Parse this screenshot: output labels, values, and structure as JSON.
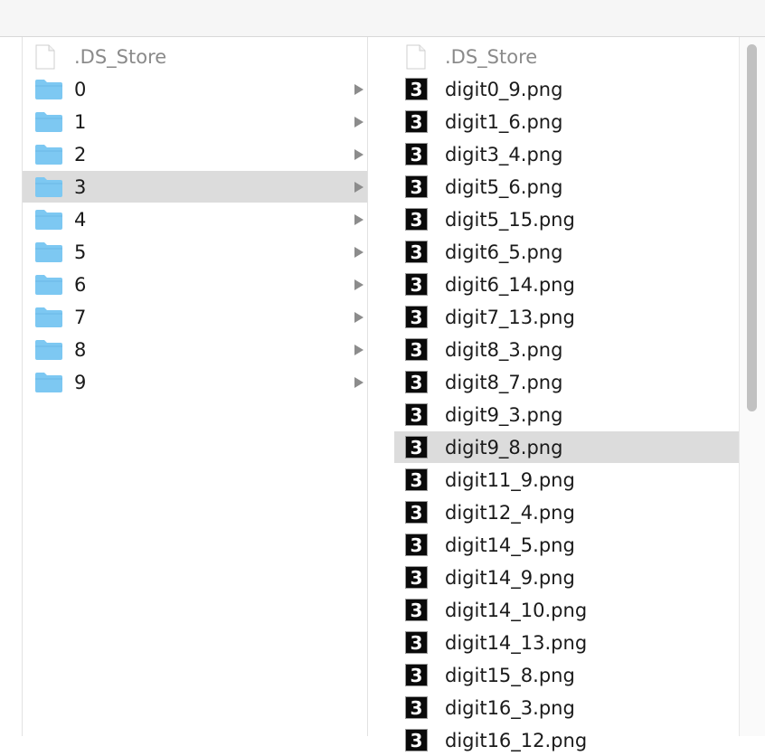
{
  "left_column": {
    "items": [
      {
        "label": ".DS_Store",
        "type": "file",
        "icon": "document-icon"
      },
      {
        "label": "0",
        "type": "folder",
        "icon": "folder-icon"
      },
      {
        "label": "1",
        "type": "folder",
        "icon": "folder-icon"
      },
      {
        "label": "2",
        "type": "folder",
        "icon": "folder-icon"
      },
      {
        "label": "3",
        "type": "folder",
        "icon": "folder-icon",
        "selected": true
      },
      {
        "label": "4",
        "type": "folder",
        "icon": "folder-icon"
      },
      {
        "label": "5",
        "type": "folder",
        "icon": "folder-icon"
      },
      {
        "label": "6",
        "type": "folder",
        "icon": "folder-icon"
      },
      {
        "label": "7",
        "type": "folder",
        "icon": "folder-icon"
      },
      {
        "label": "8",
        "type": "folder",
        "icon": "folder-icon"
      },
      {
        "label": "9",
        "type": "folder",
        "icon": "folder-icon"
      }
    ]
  },
  "right_column": {
    "items": [
      {
        "label": ".DS_Store",
        "type": "file",
        "icon": "document-icon"
      },
      {
        "label": "digit0_9.png",
        "type": "image",
        "thumb": "3"
      },
      {
        "label": "digit1_6.png",
        "type": "image",
        "thumb": "3"
      },
      {
        "label": "digit3_4.png",
        "type": "image",
        "thumb": "3"
      },
      {
        "label": "digit5_6.png",
        "type": "image",
        "thumb": "3"
      },
      {
        "label": "digit5_15.png",
        "type": "image",
        "thumb": "3"
      },
      {
        "label": "digit6_5.png",
        "type": "image",
        "thumb": "3"
      },
      {
        "label": "digit6_14.png",
        "type": "image",
        "thumb": "3"
      },
      {
        "label": "digit7_13.png",
        "type": "image",
        "thumb": "3"
      },
      {
        "label": "digit8_3.png",
        "type": "image",
        "thumb": "3"
      },
      {
        "label": "digit8_7.png",
        "type": "image",
        "thumb": "3"
      },
      {
        "label": "digit9_3.png",
        "type": "image",
        "thumb": "3"
      },
      {
        "label": "digit9_8.png",
        "type": "image",
        "thumb": "3",
        "selected": true
      },
      {
        "label": "digit11_9.png",
        "type": "image",
        "thumb": "3"
      },
      {
        "label": "digit12_4.png",
        "type": "image",
        "thumb": "3"
      },
      {
        "label": "digit14_5.png",
        "type": "image",
        "thumb": "3"
      },
      {
        "label": "digit14_9.png",
        "type": "image",
        "thumb": "3"
      },
      {
        "label": "digit14_10.png",
        "type": "image",
        "thumb": "3"
      },
      {
        "label": "digit14_13.png",
        "type": "image",
        "thumb": "3"
      },
      {
        "label": "digit15_8.png",
        "type": "image",
        "thumb": "3"
      },
      {
        "label": "digit16_3.png",
        "type": "image",
        "thumb": "3"
      },
      {
        "label": "digit16_12.png",
        "type": "image",
        "thumb": "3"
      }
    ]
  },
  "colors": {
    "folder": "#7dc8f2",
    "selection": "#dcdcdc",
    "chevron": "#8c8c8c",
    "scrollbar_thumb": "#c1c1c1"
  }
}
